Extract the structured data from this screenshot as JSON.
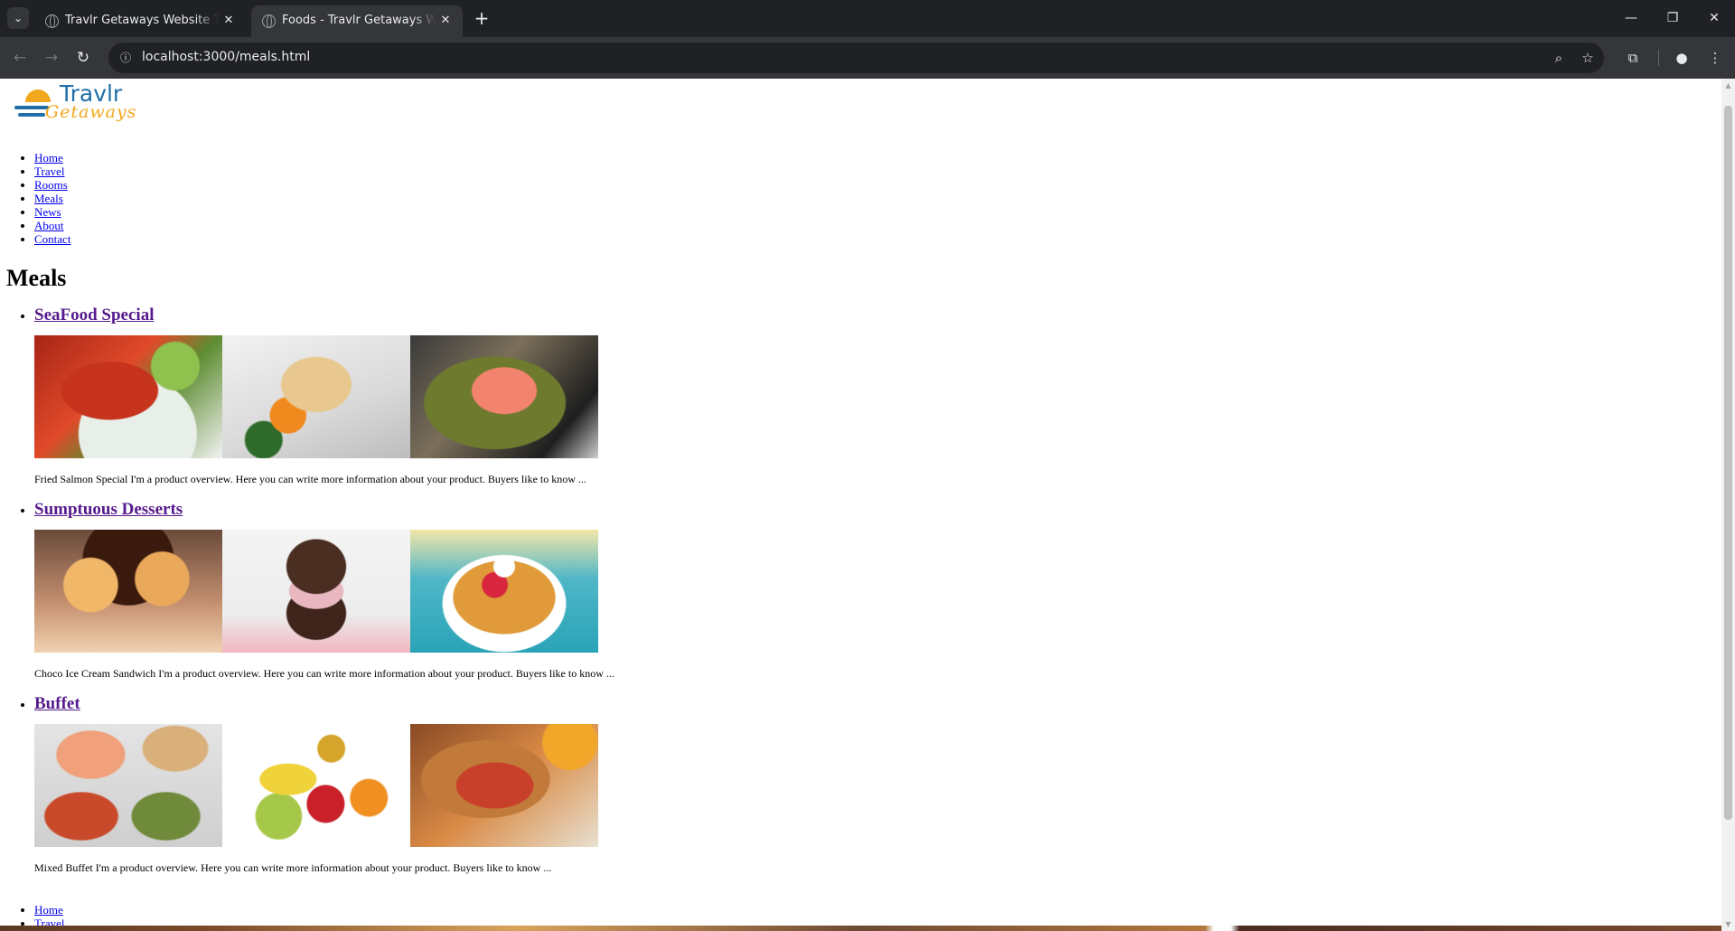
{
  "browser": {
    "tabs": [
      {
        "title": "Travlr Getaways Website Templ",
        "active": false
      },
      {
        "title": "Foods - Travlr Getaways Websi",
        "active": true
      }
    ],
    "url": "localhost:3000/meals.html"
  },
  "icons": {
    "tab_search": "chevron-down-icon",
    "back": "back-arrow-icon",
    "forward": "forward-arrow-icon",
    "reload": "reload-icon",
    "site_info": "info-icon",
    "zoom": "zoom-icon",
    "bookmark": "star-icon",
    "extensions": "puzzle-icon",
    "profile": "person-icon",
    "menu": "kebab-menu-icon",
    "tab_favicon": "globe-icon",
    "tab_close": "close-icon",
    "new_tab": "plus-icon",
    "minimize": "minimize-icon",
    "restore": "restore-icon",
    "close_window": "close-icon"
  },
  "site": {
    "logo": {
      "line1": "Travlr",
      "line2": "Getaways"
    },
    "nav": [
      "Home",
      "Travel",
      "Rooms",
      "Meals",
      "News",
      "About",
      "Contact"
    ],
    "page_title": "Meals",
    "meals": [
      {
        "title": "SeaFood Special",
        "description": "Fried Salmon Special I'm a product overview. Here you can write more information about your product. Buyers like to know ...",
        "photos": [
          "lobster",
          "plated seafood",
          "salmon in pan"
        ]
      },
      {
        "title": "Sumptuous Desserts",
        "description": "Choco Ice Cream Sandwich I'm a product overview. Here you can write more information about your product. Buyers like to know ...",
        "photos": [
          "profiteroles",
          "chocolate ice cream sandwich",
          "berry waffle"
        ]
      },
      {
        "title": "Buffet",
        "description": "Mixed Buffet I'm a product overview. Here you can write more information about your product. Buyers like to know ...",
        "photos": [
          "buffet platters",
          "fruit assortment",
          "sub sandwich"
        ]
      }
    ],
    "footer_nav": [
      "Home",
      "Travel"
    ]
  },
  "colors": {
    "chrome_dark": "#202124",
    "chrome_toolbar": "#35363a",
    "link": "#0000ee",
    "visited_link": "#551a8b",
    "logo_blue": "#1f6fa8",
    "logo_orange": "#f2a81d"
  }
}
